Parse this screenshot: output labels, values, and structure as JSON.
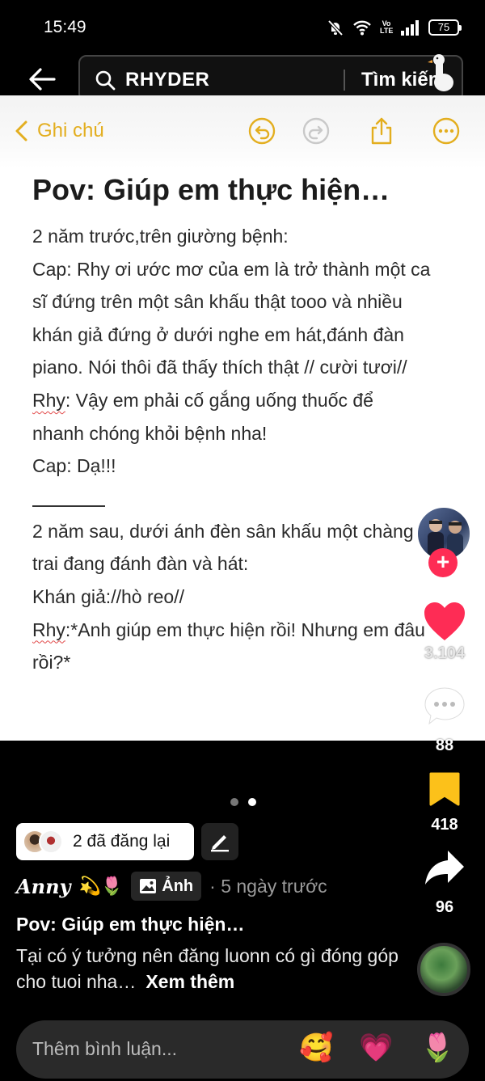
{
  "status": {
    "time": "15:49",
    "battery": "75",
    "network_label": "Vo LTE"
  },
  "search": {
    "query": "RHYDER",
    "button_label": "Tìm kiếm"
  },
  "note": {
    "back_label": "Ghi chú",
    "title": "Pov: Giúp em thực hiện…",
    "lines": [
      "2 năm trước,trên giường bệnh:",
      "Cap: Rhy ơi ước mơ của em là trở thành một ca",
      "sĩ đứng trên một sân khấu thật tooo và nhiều",
      "khán giả đứng ở dưới nghe em hát,đánh đàn",
      "piano. Nói thôi đã thấy thích thật // cười tươi//",
      "Rhy: Vậy em phải cố gắng uống thuốc để",
      "nhanh chóng khỏi bệnh nha!",
      "Cap: Dạ!!!",
      "2 năm sau, dưới ánh đèn sân khấu một chàng",
      "trai đang đánh đàn và hát:",
      "Khán giả://hò reo//",
      "Rhy:*Anh giúp em thực hiện rồi! Nhưng em đâu",
      "rồi?*"
    ]
  },
  "rail": {
    "likes": "3.104",
    "comments": "88",
    "saves": "418",
    "shares": "96"
  },
  "carousel": {
    "total": 2,
    "active": 2
  },
  "post": {
    "repost_text": "2 đã đăng lại",
    "author": "Anny",
    "author_emojis": "💫🌷",
    "type_label": "Ảnh",
    "time": "· 5 ngày trước",
    "title": "Pov: Giúp em thực hiện…",
    "description": "Tại có ý tưởng nên đăng luonn có gì đóng góp cho tuoi nha…",
    "see_more": "Xem thêm"
  },
  "comment": {
    "placeholder": "Thêm bình luận...",
    "emojis": [
      "🥰",
      "💗",
      "🌷"
    ]
  },
  "colors": {
    "accent_notes": "#e3ae1f",
    "like_red": "#fe2c55",
    "save_yellow": "#fcc11a"
  }
}
